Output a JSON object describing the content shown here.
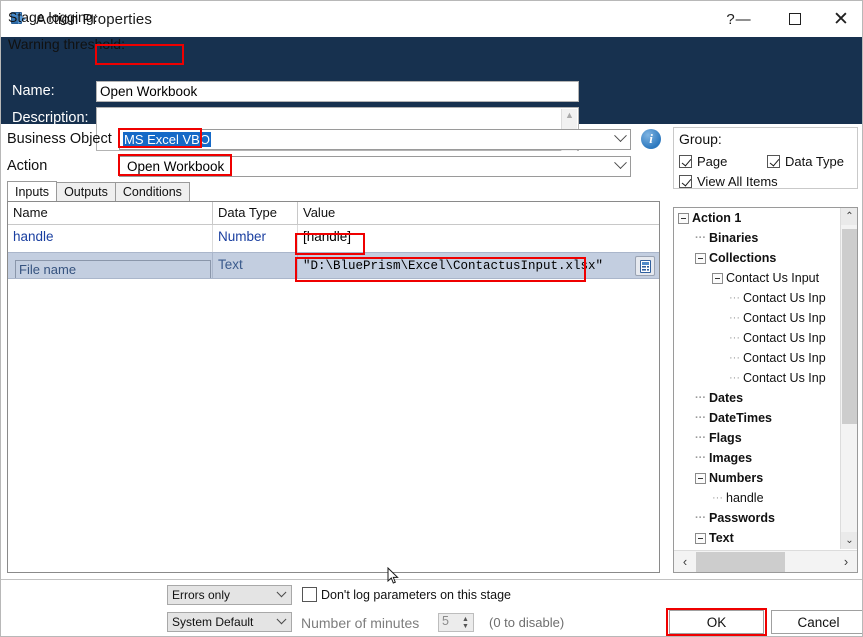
{
  "window": {
    "title": "Action Properties",
    "icon": "action-icon",
    "controls": {
      "help": "?",
      "minimize": "—",
      "maximize": "maximize-icon",
      "close": "✕"
    }
  },
  "header": {
    "name_label": "Name:",
    "name_value": "Open Workbook",
    "description_label": "Description:",
    "description_value": ""
  },
  "selectors": {
    "business_object_label": "Business Object",
    "business_object_value": "MS Excel VBO",
    "action_label": "Action",
    "action_value": "Open Workbook",
    "info_icon_glyph": "i"
  },
  "tabs": [
    {
      "label": "Inputs",
      "active": true
    },
    {
      "label": "Outputs",
      "active": false
    },
    {
      "label": "Conditions",
      "active": false
    }
  ],
  "grid": {
    "columns": [
      "Name",
      "Data Type",
      "Value"
    ],
    "rows": [
      {
        "name": "handle",
        "data_type": "Number",
        "value": "[handle]",
        "selected": false
      },
      {
        "name": "File name",
        "data_type": "Text",
        "value": "\"D:\\BluePrism\\Excel\\ContactusInput.xlsx\"",
        "selected": true
      }
    ]
  },
  "group_panel": {
    "title": "Group:",
    "checkboxes": [
      {
        "label": "Page",
        "checked": true
      },
      {
        "label": "Data Type",
        "checked": true
      },
      {
        "label": "View All Items",
        "checked": true
      }
    ]
  },
  "tree": {
    "nodes": [
      {
        "label": "Action 1",
        "depth": 0,
        "expander": "minus",
        "bold": true
      },
      {
        "label": "Binaries",
        "depth": 1,
        "expander": "none",
        "bold": true
      },
      {
        "label": "Collections",
        "depth": 1,
        "expander": "minus",
        "bold": true
      },
      {
        "label": "Contact Us Input",
        "depth": 2,
        "expander": "minus",
        "bold": false
      },
      {
        "label": "Contact Us Inp",
        "depth": 3,
        "expander": "none",
        "bold": false
      },
      {
        "label": "Contact Us Inp",
        "depth": 3,
        "expander": "none",
        "bold": false
      },
      {
        "label": "Contact Us Inp",
        "depth": 3,
        "expander": "none",
        "bold": false
      },
      {
        "label": "Contact Us Inp",
        "depth": 3,
        "expander": "none",
        "bold": false
      },
      {
        "label": "Contact Us Inp",
        "depth": 3,
        "expander": "none",
        "bold": false
      },
      {
        "label": "Dates",
        "depth": 1,
        "expander": "none",
        "bold": true
      },
      {
        "label": "DateTimes",
        "depth": 1,
        "expander": "none",
        "bold": true
      },
      {
        "label": "Flags",
        "depth": 1,
        "expander": "none",
        "bold": true
      },
      {
        "label": "Images",
        "depth": 1,
        "expander": "none",
        "bold": true
      },
      {
        "label": "Numbers",
        "depth": 1,
        "expander": "minus",
        "bold": true
      },
      {
        "label": "handle",
        "depth": 2,
        "expander": "none",
        "bold": false
      },
      {
        "label": "Passwords",
        "depth": 1,
        "expander": "none",
        "bold": true
      },
      {
        "label": "Text",
        "depth": 1,
        "expander": "minus",
        "bold": true
      }
    ],
    "scroll_up_glyph": "⌃",
    "scroll_down_glyph": "⌄",
    "scroll_left_glyph": "‹",
    "scroll_right_glyph": "›"
  },
  "footer": {
    "stage_logging_label": "Stage logging:",
    "stage_logging_value": "Errors only",
    "warning_threshold_label": "Warning threshold:",
    "warning_threshold_value": "System Default",
    "dont_log_label": "Don't log parameters on this stage",
    "dont_log_checked": false,
    "minutes_label": "Number of minutes",
    "minutes_value": "5",
    "disable_note": "(0 to disable)",
    "ok_label": "OK",
    "cancel_label": "Cancel"
  },
  "annotations": {
    "color": "#ef0000",
    "boxes": [
      "name-value",
      "business-object-value",
      "action-value",
      "handle-value",
      "file-name-value",
      "ok-button"
    ]
  }
}
